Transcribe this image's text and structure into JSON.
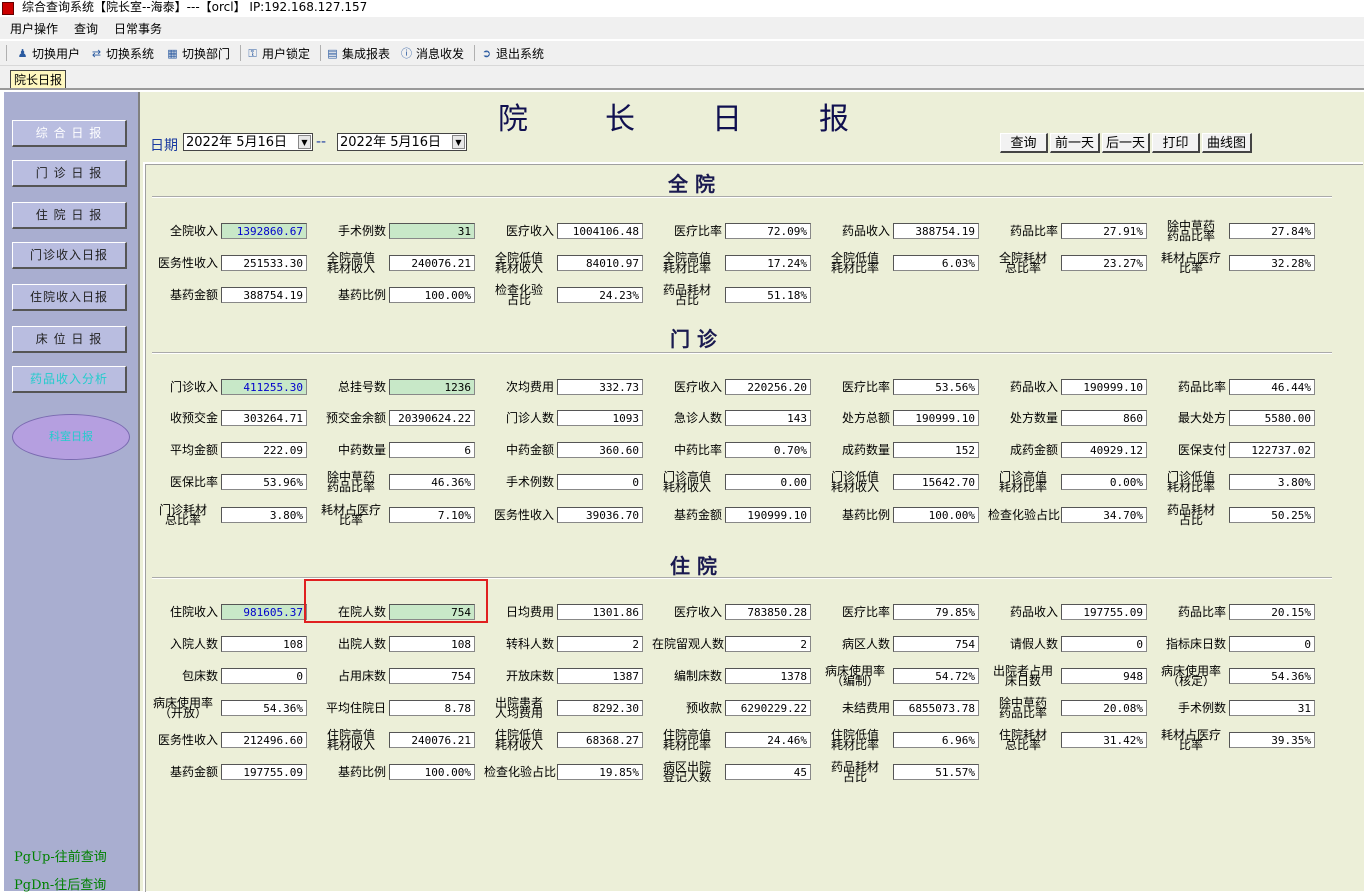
{
  "window": {
    "title": "综合查询系统【院长室--海泰】---【orcl】 IP:192.168.127.157"
  },
  "menu": [
    "用户操作",
    "查询",
    "日常事务"
  ],
  "toolbar": [
    "切换用户",
    "切换系统",
    "切换部门",
    "用户锁定",
    "集成报表",
    "消息收发",
    "退出系统"
  ],
  "tab": {
    "label": "院长日报"
  },
  "sidebar": {
    "buttons": [
      "综 合 日 报",
      "门 诊 日 报",
      "住 院 日 报",
      "门诊收入日报",
      "住院收入日报",
      "床 位 日 报",
      "药品收入分析"
    ],
    "oval": "科室日报",
    "pgup": "PgUp-往前查询",
    "pgdn": "PgDn-往后查询"
  },
  "header": {
    "title_chars": [
      "院",
      "长",
      "日",
      "报"
    ],
    "date_label": "日期",
    "date_from": "2022年 5月16日",
    "date_sep": "--",
    "date_to": "2022年 5月16日",
    "buttons": [
      "查询",
      "前一天",
      "后一天",
      "打印",
      "曲线图"
    ]
  },
  "sections": [
    {
      "title": "全 院",
      "rows": [
        [
          [
            "全院收入",
            "1392860.67",
            "green"
          ],
          [
            "手术例数",
            "31",
            "green"
          ],
          [
            "医疗收入",
            "1004106.48",
            ""
          ],
          [
            "医疗比率",
            "72.09%",
            ""
          ],
          [
            "药品收入",
            "388754.19",
            ""
          ],
          [
            "药品比率",
            "27.91%",
            ""
          ],
          [
            "除中草药\n药品比率",
            "27.84%",
            ""
          ]
        ],
        [
          [
            "医务性收入",
            "251533.30",
            ""
          ],
          [
            "全院高值\n耗材收入",
            "240076.21",
            ""
          ],
          [
            "全院低值\n耗材收入",
            "84010.97",
            ""
          ],
          [
            "全院高值\n耗材比率",
            "17.24%",
            ""
          ],
          [
            "全院低值\n耗材比率",
            "6.03%",
            ""
          ],
          [
            "全院耗材\n总比率",
            "23.27%",
            ""
          ],
          [
            "耗材占医疗\n比率",
            "32.28%",
            ""
          ]
        ],
        [
          [
            "基药金额",
            "388754.19",
            ""
          ],
          [
            "基药比例",
            "100.00%",
            ""
          ],
          [
            "检查化验\n占比",
            "24.23%",
            ""
          ],
          [
            "药品耗材\n占比",
            "51.18%",
            ""
          ]
        ]
      ]
    },
    {
      "title": "门 诊",
      "rows": [
        [
          [
            "门诊收入",
            "411255.30",
            "green"
          ],
          [
            "总挂号数",
            "1236",
            "green"
          ],
          [
            "次均费用",
            "332.73",
            ""
          ],
          [
            "医疗收入",
            "220256.20",
            ""
          ],
          [
            "医疗比率",
            "53.56%",
            ""
          ],
          [
            "药品收入",
            "190999.10",
            ""
          ],
          [
            "药品比率",
            "46.44%",
            ""
          ]
        ],
        [
          [
            "收预交金",
            "303264.71",
            ""
          ],
          [
            "预交金余额",
            "20390624.22",
            ""
          ],
          [
            "门诊人数",
            "1093",
            ""
          ],
          [
            "急诊人数",
            "143",
            ""
          ],
          [
            "处方总额",
            "190999.10",
            ""
          ],
          [
            "处方数量",
            "860",
            ""
          ],
          [
            "最大处方",
            "5580.00",
            ""
          ]
        ],
        [
          [
            "平均金额",
            "222.09",
            ""
          ],
          [
            "中药数量",
            "6",
            ""
          ],
          [
            "中药金额",
            "360.60",
            ""
          ],
          [
            "中药比率",
            "0.70%",
            ""
          ],
          [
            "成药数量",
            "152",
            ""
          ],
          [
            "成药金额",
            "40929.12",
            ""
          ],
          [
            "医保支付",
            "122737.02",
            ""
          ]
        ],
        [
          [
            "医保比率",
            "53.96%",
            ""
          ],
          [
            "除中草药\n药品比率",
            "46.36%",
            ""
          ],
          [
            "手术例数",
            "0",
            ""
          ],
          [
            "门诊高值\n耗材收入",
            "0.00",
            ""
          ],
          [
            "门诊低值\n耗材收入",
            "15642.70",
            ""
          ],
          [
            "门诊高值\n耗材比率",
            "0.00%",
            ""
          ],
          [
            "门诊低值\n耗材比率",
            "3.80%",
            ""
          ]
        ],
        [
          [
            "门诊耗材\n总比率",
            "3.80%",
            ""
          ],
          [
            "耗材占医疗\n比率",
            "7.10%",
            ""
          ],
          [
            "医务性收入",
            "39036.70",
            ""
          ],
          [
            "基药金额",
            "190999.10",
            ""
          ],
          [
            "基药比例",
            "100.00%",
            ""
          ],
          [
            "检查化验占比",
            "34.70%",
            ""
          ],
          [
            "药品耗材\n占比",
            "50.25%",
            ""
          ]
        ]
      ]
    },
    {
      "title": "住 院",
      "rows": [
        [
          [
            "住院收入",
            "981605.37",
            "green"
          ],
          [
            "在院人数",
            "754",
            "green"
          ],
          [
            "日均费用",
            "1301.86",
            ""
          ],
          [
            "医疗收入",
            "783850.28",
            ""
          ],
          [
            "医疗比率",
            "79.85%",
            ""
          ],
          [
            "药品收入",
            "197755.09",
            ""
          ],
          [
            "药品比率",
            "20.15%",
            ""
          ]
        ],
        [
          [
            "入院人数",
            "108",
            ""
          ],
          [
            "出院人数",
            "108",
            ""
          ],
          [
            "转科人数",
            "2",
            ""
          ],
          [
            "在院留观人数",
            "2",
            ""
          ],
          [
            "病区人数",
            "754",
            ""
          ],
          [
            "请假人数",
            "0",
            ""
          ],
          [
            "指标床日数",
            "0",
            ""
          ]
        ],
        [
          [
            "包床数",
            "0",
            ""
          ],
          [
            "占用床数",
            "754",
            ""
          ],
          [
            "开放床数",
            "1387",
            ""
          ],
          [
            "编制床数",
            "1378",
            ""
          ],
          [
            "病床使用率\n（编制）",
            "54.72%",
            ""
          ],
          [
            "出院者占用\n床日数",
            "948",
            ""
          ],
          [
            "病床使用率\n（核定）",
            "54.36%",
            ""
          ]
        ],
        [
          [
            "病床使用率\n（开放）",
            "54.36%",
            ""
          ],
          [
            "平均住院日",
            "8.78",
            ""
          ],
          [
            "出院患者\n人均费用",
            "8292.30",
            ""
          ],
          [
            "预收款",
            "6290229.22",
            ""
          ],
          [
            "未结费用",
            "6855073.78",
            ""
          ],
          [
            "除中草药\n药品比率",
            "20.08%",
            ""
          ],
          [
            "手术例数",
            "31",
            ""
          ]
        ],
        [
          [
            "医务性收入",
            "212496.60",
            ""
          ],
          [
            "住院高值\n耗材收入",
            "240076.21",
            ""
          ],
          [
            "住院低值\n耗材收入",
            "68368.27",
            ""
          ],
          [
            "住院高值\n耗材比率",
            "24.46%",
            ""
          ],
          [
            "住院低值\n耗材比率",
            "6.96%",
            ""
          ],
          [
            "住院耗材\n总比率",
            "31.42%",
            ""
          ],
          [
            "耗材占医疗\n比率",
            "39.35%",
            ""
          ]
        ],
        [
          [
            "基药金额",
            "197755.09",
            ""
          ],
          [
            "基药比例",
            "100.00%",
            ""
          ],
          [
            "检查化验占比",
            "19.85%",
            ""
          ],
          [
            "病区出院\n登记人数",
            "45",
            ""
          ],
          [
            "药品耗材\n占比",
            "51.57%",
            ""
          ]
        ]
      ]
    }
  ]
}
